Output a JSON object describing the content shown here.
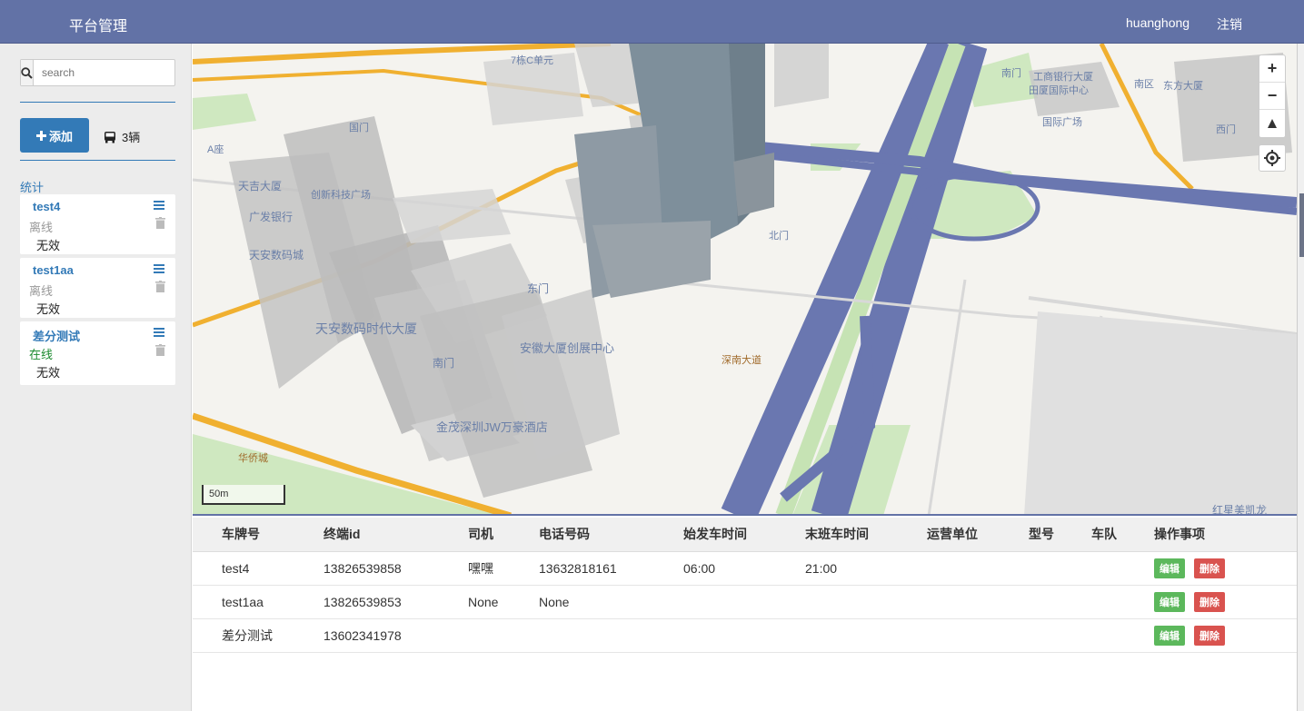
{
  "header": {
    "brand": "平台管理",
    "username": "huanghong",
    "logout": "注销"
  },
  "sidebar": {
    "search_placeholder": "search",
    "add_label": "添加",
    "bus_count": "3辆",
    "stats_label": "统计",
    "vehicles": [
      {
        "name": "test4",
        "status": "离线",
        "validity": "无效"
      },
      {
        "name": "test1aa",
        "status": "离线",
        "validity": "无效"
      },
      {
        "name": "差分测试",
        "status": "在线",
        "validity": "无效"
      }
    ]
  },
  "map": {
    "scale": "50m",
    "labels": [
      "7栋C单元",
      "国门",
      "A座",
      "天吉大厦",
      "广发银行",
      "创新科技广场",
      "天安数码城",
      "天安数码时代大厦",
      "南门",
      "安徽大厦创展中心",
      "金茂深圳JW万豪酒店",
      "东门",
      "北门",
      "深南大道",
      "华侨城",
      "红星美凯龙",
      "南门",
      "工商银行大厦",
      "田厦国际中心",
      "国际广场",
      "南区",
      "东方大厦",
      "西门"
    ]
  },
  "table": {
    "headers": [
      "车牌号",
      "终端id",
      "司机",
      "电话号码",
      "始发车时间",
      "末班车时间",
      "运营单位",
      "型号",
      "车队",
      "操作事项"
    ],
    "rows": [
      [
        "test4",
        "13826539858",
        "嘿嘿",
        "13632818161",
        "06:00",
        "21:00",
        "",
        "",
        ""
      ],
      [
        "test1aa",
        "13826539853",
        "None",
        "None",
        "",
        "",
        "",
        "",
        ""
      ],
      [
        "差分测试",
        "13602341978",
        "",
        "",
        "",
        "",
        "",
        "",
        ""
      ]
    ],
    "edit_label": "编辑",
    "delete_label": "删除"
  }
}
